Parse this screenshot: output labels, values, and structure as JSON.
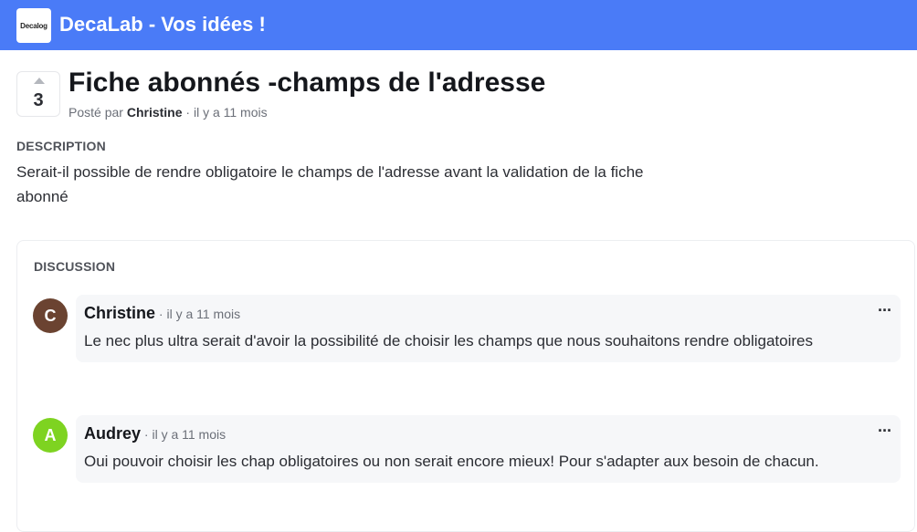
{
  "header": {
    "logo_text": "Decalog",
    "title": "DecaLab - Vos idées !",
    "bar_color": "#4a7bf7"
  },
  "post": {
    "votes": "3",
    "title": "Fiche abonnés -champs de l'adresse",
    "meta_prefix": "Posté par",
    "author": "Christine",
    "time": "· il y a 11 mois",
    "description_label": "DESCRIPTION",
    "description": "Serait-il possible de rendre obligatoire le champs de l'adresse avant la validation de la fiche abonné"
  },
  "discussion": {
    "label": "DISCUSSION",
    "comments": [
      {
        "avatar_letter": "C",
        "avatar_color": "#6b4331",
        "author": "Christine",
        "time": "· il y a 11 mois",
        "menu": "···",
        "text": "Le nec plus ultra serait d'avoir la possibilité de choisir les champs que nous souhaitons rendre obligatoires"
      },
      {
        "avatar_letter": "A",
        "avatar_color": "#7ed321",
        "author": "Audrey",
        "time": "· il y a 11 mois",
        "menu": "···",
        "text": "Oui pouvoir choisir les chap obligatoires ou non serait encore mieux! Pour s'adapter aux besoin de chacun."
      }
    ]
  }
}
